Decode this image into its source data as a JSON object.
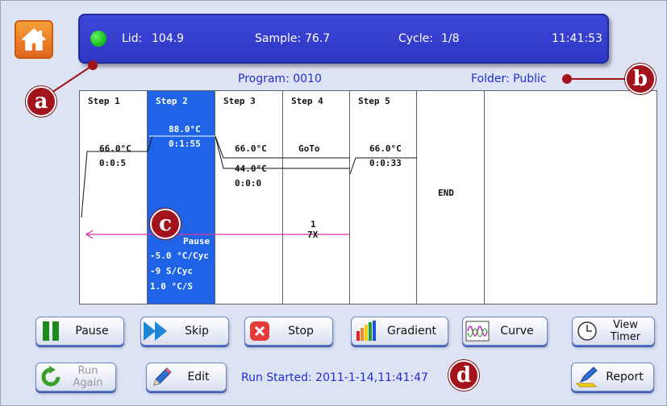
{
  "status": {
    "lid_label": "Lid:",
    "lid_value": "104.9",
    "sample_label": "Sample:",
    "sample_value": "76.7",
    "cycle_label": "Cycle:",
    "cycle_value": "1/8",
    "time": "11:41:53",
    "indicator_color": "#22c722"
  },
  "header": {
    "program": "Program: 0010",
    "folder": "Folder: Public"
  },
  "steps": [
    {
      "label": "Step 1",
      "temp": "66.0°C",
      "time": "0:0:5"
    },
    {
      "label": "Step 2",
      "temp": "88.0°C",
      "time": "0:1:55",
      "pause": "Pause",
      "details": [
        "-5.0  °C/Cyc",
        "-9   S/Cyc",
        "1.0  °C/S"
      ]
    },
    {
      "label": "Step 3",
      "temp_a": "66.0°C",
      "temp_b": "44.0°C",
      "time": "0:0:0"
    },
    {
      "label": "Step 4",
      "goto": "GoTo",
      "goto_step": "1",
      "repeat": "7X"
    },
    {
      "label": "Step 5",
      "temp": "66.0°C",
      "time": "0:0:33"
    },
    {
      "end": "END"
    }
  ],
  "buttons": {
    "pause": "Pause",
    "skip": "Skip",
    "stop": "Stop",
    "gradient": "Gradient",
    "curve": "Curve",
    "view_timer_1": "View",
    "view_timer_2": "Timer",
    "run_again_1": "Run",
    "run_again_2": "Again",
    "edit": "Edit",
    "report": "Report"
  },
  "run_started": "Run Started: 2011-1-14,11:41:47",
  "markers": {
    "a": "a",
    "b": "b",
    "c": "c",
    "d": "d"
  },
  "colors": {
    "accent": "#2e37c4",
    "highlight": "#1f63e6",
    "marker": "#a3131b",
    "cycle_line": "#d0309a"
  }
}
